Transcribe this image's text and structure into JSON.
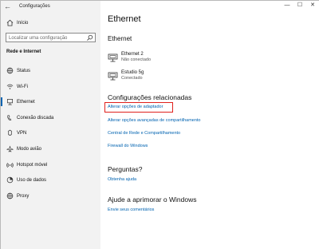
{
  "window": {
    "title": "Configurações"
  },
  "sidebar": {
    "home_label": "Início",
    "search_placeholder": "Localizar uma configuração",
    "section_title": "Rede e Internet",
    "items": [
      {
        "label": "Status",
        "icon": "globe-icon"
      },
      {
        "label": "Wi-Fi",
        "icon": "wifi-icon"
      },
      {
        "label": "Ethernet",
        "icon": "ethernet-icon",
        "active": true
      },
      {
        "label": "Conexão discada",
        "icon": "dialup-icon"
      },
      {
        "label": "VPN",
        "icon": "vpn-icon"
      },
      {
        "label": "Modo avião",
        "icon": "airplane-icon"
      },
      {
        "label": "Hotspot móvel",
        "icon": "hotspot-icon"
      },
      {
        "label": "Uso de dados",
        "icon": "data-usage-icon"
      },
      {
        "label": "Proxy",
        "icon": "proxy-icon"
      }
    ]
  },
  "window_controls": {
    "minimize": "—",
    "maximize": "☐",
    "close": "✕"
  },
  "main": {
    "title": "Ethernet",
    "subtitle": "Ethernet",
    "networks": [
      {
        "name": "Ethernet 2",
        "status": "Não conectado"
      },
      {
        "name": "Estudio 5g",
        "status": "Conectado"
      }
    ],
    "related": {
      "heading": "Configurações relacionadas",
      "links": [
        "Alterar opções de adaptador",
        "Alterar opções avançadas de compartilhamento",
        "Central de Rede e Compartilhamento",
        "Firewall do Windows"
      ]
    },
    "questions": {
      "heading": "Perguntas?",
      "link": "Obtenha ajuda"
    },
    "improve": {
      "heading": "Ajude a aprimorar o Windows",
      "link": "Envie seus comentários"
    }
  },
  "colors": {
    "accent": "#0063b1",
    "highlight": "#e0201c",
    "sidebar_bg": "#f2f2f2"
  }
}
